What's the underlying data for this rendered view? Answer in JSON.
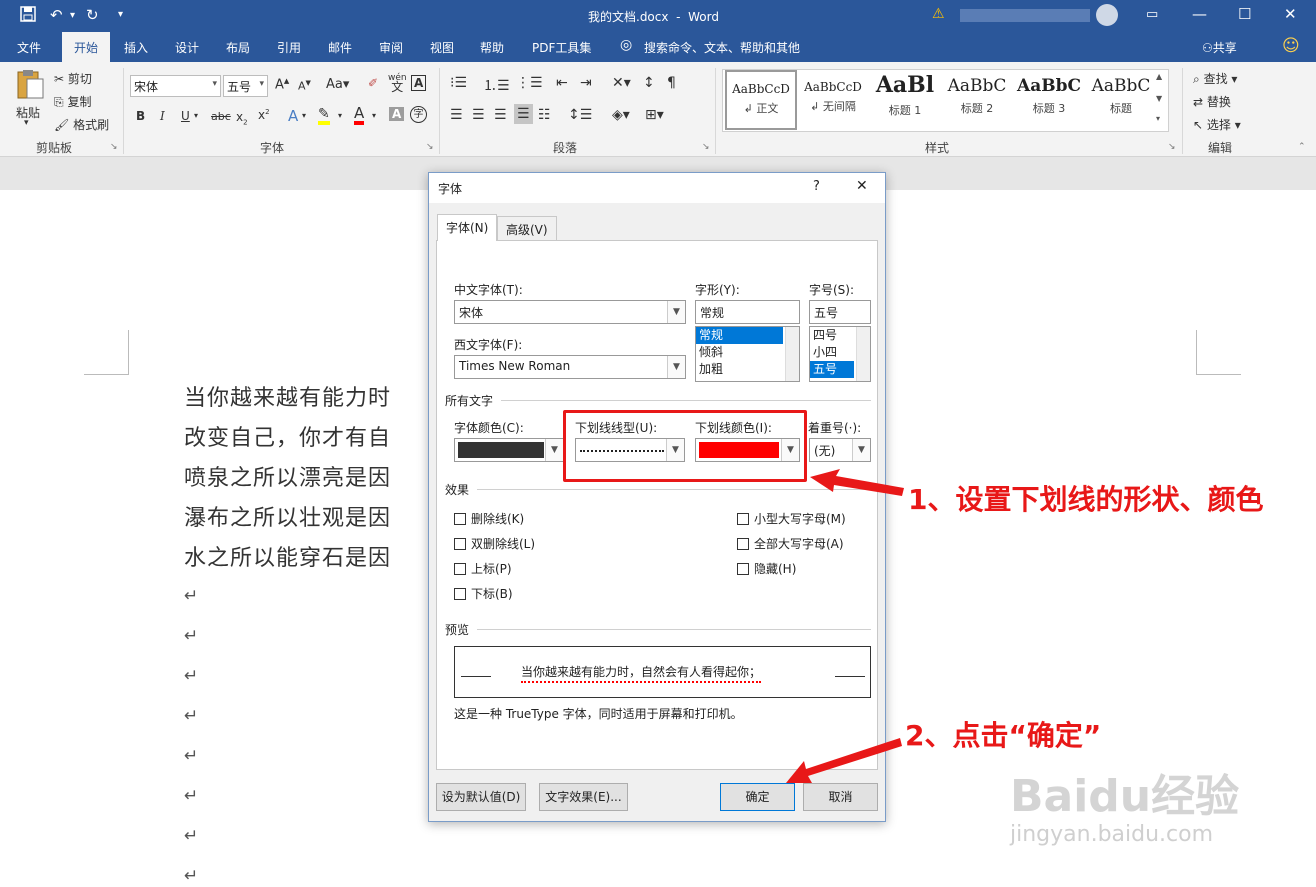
{
  "window": {
    "doc_title": "我的文档.docx",
    "separator": "-",
    "app_name": "Word"
  },
  "tabs": [
    {
      "label": "文件"
    },
    {
      "label": "开始"
    },
    {
      "label": "插入"
    },
    {
      "label": "设计"
    },
    {
      "label": "布局"
    },
    {
      "label": "引用"
    },
    {
      "label": "邮件"
    },
    {
      "label": "审阅"
    },
    {
      "label": "视图"
    },
    {
      "label": "帮助"
    },
    {
      "label": "PDF工具集"
    }
  ],
  "tell_me": "搜索命令、文本、帮助和其他",
  "share": "共享",
  "clipboard": {
    "paste": "粘贴",
    "cut": "剪切",
    "copy": "复制",
    "format_painter": "格式刷",
    "group_label": "剪贴板"
  },
  "font_group": {
    "font_name": "宋体",
    "font_size": "五号",
    "group_label": "字体",
    "wen_top": "wén",
    "wen_char": "文",
    "a_box": "A",
    "circle_char": "字"
  },
  "paragraph_group": {
    "group_label": "段落"
  },
  "styles": {
    "items": [
      {
        "preview": "AaBbCcD",
        "name": "正文"
      },
      {
        "preview": "AaBbCcD",
        "name": "无间隔"
      },
      {
        "preview": "AaBl",
        "name": "标题 1"
      },
      {
        "preview": "AaBbC",
        "name": "标题 2"
      },
      {
        "preview": "AaBbC",
        "name": "标题 3"
      },
      {
        "preview": "AaBbC",
        "name": "标题"
      }
    ],
    "group_label": "样式",
    "first_prefix": "↲"
  },
  "editing": {
    "find": "查找",
    "replace": "替换",
    "select": "选择",
    "group_label": "编辑"
  },
  "document": {
    "lines": [
      "当你越来越有能力时",
      "改变自己，你才有自",
      "喷泉之所以漂亮是因",
      "瀑布之所以壮观是因",
      "水之所以能穿石是因"
    ],
    "return_mark": "↵"
  },
  "dialog": {
    "title": "字体",
    "help": "?",
    "close": "✕",
    "tabs": [
      "字体(N)",
      "高级(V)"
    ],
    "cn_font_label": "中文字体(T):",
    "cn_font_value": "宋体",
    "west_font_label": "西文字体(F):",
    "west_font_value": "Times New Roman",
    "style_label": "字形(Y):",
    "style_value": "常规",
    "style_options": [
      "常规",
      "倾斜",
      "加粗"
    ],
    "size_label": "字号(S):",
    "size_value": "五号",
    "size_options": [
      "四号",
      "小四",
      "五号"
    ],
    "all_text_section": "所有文字",
    "font_color_label": "字体颜色(C):",
    "underline_style_label": "下划线线型(U):",
    "underline_color_label": "下划线颜色(I):",
    "emphasis_label": "着重号(·):",
    "emphasis_value": "(无)",
    "effects_section": "效果",
    "effects_left": [
      "删除线(K)",
      "双删除线(L)",
      "上标(P)",
      "下标(B)"
    ],
    "effects_right": [
      "小型大写字母(M)",
      "全部大写字母(A)",
      "隐藏(H)"
    ],
    "preview_section": "预览",
    "preview_text": "当你越来越有能力时，自然会有人看得起你；",
    "truetype_note": "这是一种 TrueType 字体，同时适用于屏幕和打印机。",
    "buttons": {
      "default": "设为默认值(D)",
      "text_effects": "文字效果(E)...",
      "ok": "确定",
      "cancel": "取消"
    },
    "colors": {
      "font_color": "#333333",
      "underline_color": "#ff0000"
    }
  },
  "annotations": {
    "step1": "1、设置下划线的形状、颜色",
    "step2": "2、点击“确定”"
  },
  "watermark": {
    "brand": "Baidu经验",
    "url": "jingyan.baidu.com"
  }
}
